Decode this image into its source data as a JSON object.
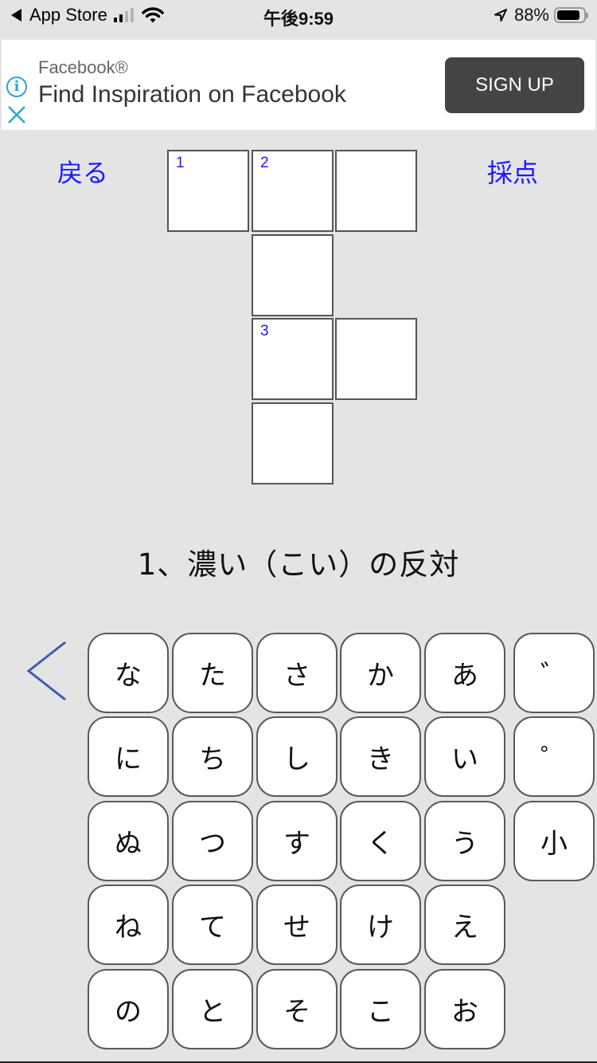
{
  "status_bar": {
    "back_app": "App Store",
    "time": "午後9:59",
    "battery": "88%",
    "battery_level": 0.88,
    "signal_bars": 2,
    "signal_total": 4
  },
  "ad": {
    "brand": "Facebook®",
    "headline": "Find Inspiration on Facebook",
    "cta": "SIGN UP",
    "info_icon": "info-icon",
    "close_icon": "close-icon"
  },
  "nav": {
    "back_label": "戻る",
    "grade_label": "採点"
  },
  "crossword": {
    "cells": [
      {
        "row": 0,
        "col": 0,
        "number": "1",
        "value": ""
      },
      {
        "row": 0,
        "col": 1,
        "number": "2",
        "value": ""
      },
      {
        "row": 0,
        "col": 2,
        "number": "",
        "value": ""
      },
      {
        "row": 1,
        "col": 1,
        "number": "",
        "value": ""
      },
      {
        "row": 2,
        "col": 1,
        "number": "3",
        "value": ""
      },
      {
        "row": 2,
        "col": 2,
        "number": "",
        "value": ""
      },
      {
        "row": 3,
        "col": 1,
        "number": "",
        "value": ""
      }
    ]
  },
  "clue": {
    "text": "1、濃い（こい）の反対"
  },
  "keyboard": {
    "back_icon": "chevron-left-icon",
    "rows": [
      [
        "な",
        "た",
        "さ",
        "か",
        "あ",
        "゛"
      ],
      [
        "に",
        "ち",
        "し",
        "き",
        "い",
        "゜"
      ],
      [
        "ぬ",
        "つ",
        "す",
        "く",
        "う",
        "小"
      ],
      [
        "ね",
        "て",
        "せ",
        "け",
        "え"
      ],
      [
        "の",
        "と",
        "そ",
        "こ",
        "お"
      ]
    ]
  },
  "colors": {
    "background": "#e4e4e4",
    "link_blue": "#1a1aff",
    "back_arrow": "#3f5bb0",
    "ad_cta_bg": "#444444",
    "ad_icon": "#2aa6d0"
  }
}
